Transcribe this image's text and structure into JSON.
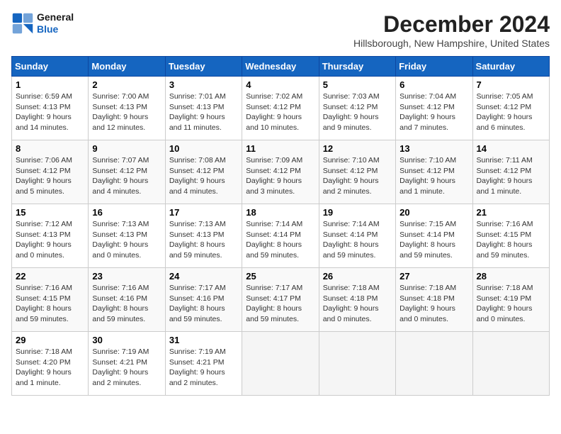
{
  "logo": {
    "line1": "General",
    "line2": "Blue"
  },
  "title": "December 2024",
  "subtitle": "Hillsborough, New Hampshire, United States",
  "days_of_week": [
    "Sunday",
    "Monday",
    "Tuesday",
    "Wednesday",
    "Thursday",
    "Friday",
    "Saturday"
  ],
  "weeks": [
    [
      {
        "day": "1",
        "info": "Sunrise: 6:59 AM\nSunset: 4:13 PM\nDaylight: 9 hours\nand 14 minutes."
      },
      {
        "day": "2",
        "info": "Sunrise: 7:00 AM\nSunset: 4:13 PM\nDaylight: 9 hours\nand 12 minutes."
      },
      {
        "day": "3",
        "info": "Sunrise: 7:01 AM\nSunset: 4:13 PM\nDaylight: 9 hours\nand 11 minutes."
      },
      {
        "day": "4",
        "info": "Sunrise: 7:02 AM\nSunset: 4:12 PM\nDaylight: 9 hours\nand 10 minutes."
      },
      {
        "day": "5",
        "info": "Sunrise: 7:03 AM\nSunset: 4:12 PM\nDaylight: 9 hours\nand 9 minutes."
      },
      {
        "day": "6",
        "info": "Sunrise: 7:04 AM\nSunset: 4:12 PM\nDaylight: 9 hours\nand 7 minutes."
      },
      {
        "day": "7",
        "info": "Sunrise: 7:05 AM\nSunset: 4:12 PM\nDaylight: 9 hours\nand 6 minutes."
      }
    ],
    [
      {
        "day": "8",
        "info": "Sunrise: 7:06 AM\nSunset: 4:12 PM\nDaylight: 9 hours\nand 5 minutes."
      },
      {
        "day": "9",
        "info": "Sunrise: 7:07 AM\nSunset: 4:12 PM\nDaylight: 9 hours\nand 4 minutes."
      },
      {
        "day": "10",
        "info": "Sunrise: 7:08 AM\nSunset: 4:12 PM\nDaylight: 9 hours\nand 4 minutes."
      },
      {
        "day": "11",
        "info": "Sunrise: 7:09 AM\nSunset: 4:12 PM\nDaylight: 9 hours\nand 3 minutes."
      },
      {
        "day": "12",
        "info": "Sunrise: 7:10 AM\nSunset: 4:12 PM\nDaylight: 9 hours\nand 2 minutes."
      },
      {
        "day": "13",
        "info": "Sunrise: 7:10 AM\nSunset: 4:12 PM\nDaylight: 9 hours\nand 1 minute."
      },
      {
        "day": "14",
        "info": "Sunrise: 7:11 AM\nSunset: 4:12 PM\nDaylight: 9 hours\nand 1 minute."
      }
    ],
    [
      {
        "day": "15",
        "info": "Sunrise: 7:12 AM\nSunset: 4:13 PM\nDaylight: 9 hours\nand 0 minutes."
      },
      {
        "day": "16",
        "info": "Sunrise: 7:13 AM\nSunset: 4:13 PM\nDaylight: 9 hours\nand 0 minutes."
      },
      {
        "day": "17",
        "info": "Sunrise: 7:13 AM\nSunset: 4:13 PM\nDaylight: 8 hours\nand 59 minutes."
      },
      {
        "day": "18",
        "info": "Sunrise: 7:14 AM\nSunset: 4:14 PM\nDaylight: 8 hours\nand 59 minutes."
      },
      {
        "day": "19",
        "info": "Sunrise: 7:14 AM\nSunset: 4:14 PM\nDaylight: 8 hours\nand 59 minutes."
      },
      {
        "day": "20",
        "info": "Sunrise: 7:15 AM\nSunset: 4:14 PM\nDaylight: 8 hours\nand 59 minutes."
      },
      {
        "day": "21",
        "info": "Sunrise: 7:16 AM\nSunset: 4:15 PM\nDaylight: 8 hours\nand 59 minutes."
      }
    ],
    [
      {
        "day": "22",
        "info": "Sunrise: 7:16 AM\nSunset: 4:15 PM\nDaylight: 8 hours\nand 59 minutes."
      },
      {
        "day": "23",
        "info": "Sunrise: 7:16 AM\nSunset: 4:16 PM\nDaylight: 8 hours\nand 59 minutes."
      },
      {
        "day": "24",
        "info": "Sunrise: 7:17 AM\nSunset: 4:16 PM\nDaylight: 8 hours\nand 59 minutes."
      },
      {
        "day": "25",
        "info": "Sunrise: 7:17 AM\nSunset: 4:17 PM\nDaylight: 8 hours\nand 59 minutes."
      },
      {
        "day": "26",
        "info": "Sunrise: 7:18 AM\nSunset: 4:18 PM\nDaylight: 9 hours\nand 0 minutes."
      },
      {
        "day": "27",
        "info": "Sunrise: 7:18 AM\nSunset: 4:18 PM\nDaylight: 9 hours\nand 0 minutes."
      },
      {
        "day": "28",
        "info": "Sunrise: 7:18 AM\nSunset: 4:19 PM\nDaylight: 9 hours\nand 0 minutes."
      }
    ],
    [
      {
        "day": "29",
        "info": "Sunrise: 7:18 AM\nSunset: 4:20 PM\nDaylight: 9 hours\nand 1 minute."
      },
      {
        "day": "30",
        "info": "Sunrise: 7:19 AM\nSunset: 4:21 PM\nDaylight: 9 hours\nand 2 minutes."
      },
      {
        "day": "31",
        "info": "Sunrise: 7:19 AM\nSunset: 4:21 PM\nDaylight: 9 hours\nand 2 minutes."
      },
      null,
      null,
      null,
      null
    ]
  ]
}
